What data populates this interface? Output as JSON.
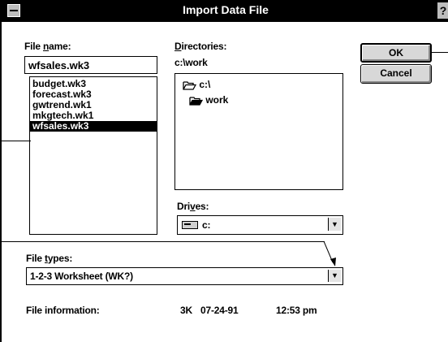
{
  "window": {
    "title": "Import Data File",
    "help_glyph": "?"
  },
  "file_name": {
    "label_pre": "File ",
    "label_key": "n",
    "label_post": "ame:",
    "value": "wfsales.wk3",
    "files": [
      "budget.wk3",
      "forecast.wk3",
      "gwtrend.wk1",
      "mkgtech.wk1",
      "wfsales.wk3"
    ],
    "selected_index": 4
  },
  "directories": {
    "label_key": "D",
    "label_post": "irectories:",
    "current": "c:\\work",
    "tree": [
      "c:\\",
      "work"
    ]
  },
  "drives": {
    "label_pre": "Dri",
    "label_key": "v",
    "label_post": "es:",
    "value": "c:"
  },
  "file_types": {
    "label_pre": "File ",
    "label_key": "t",
    "label_post": "ypes:",
    "value": "1-2-3 Worksheet (WK?)"
  },
  "file_info": {
    "label": "File information:",
    "size": "3K",
    "date": "07-24-91",
    "time": "12:53 pm"
  },
  "buttons": {
    "ok": "OK",
    "cancel": "Cancel"
  }
}
